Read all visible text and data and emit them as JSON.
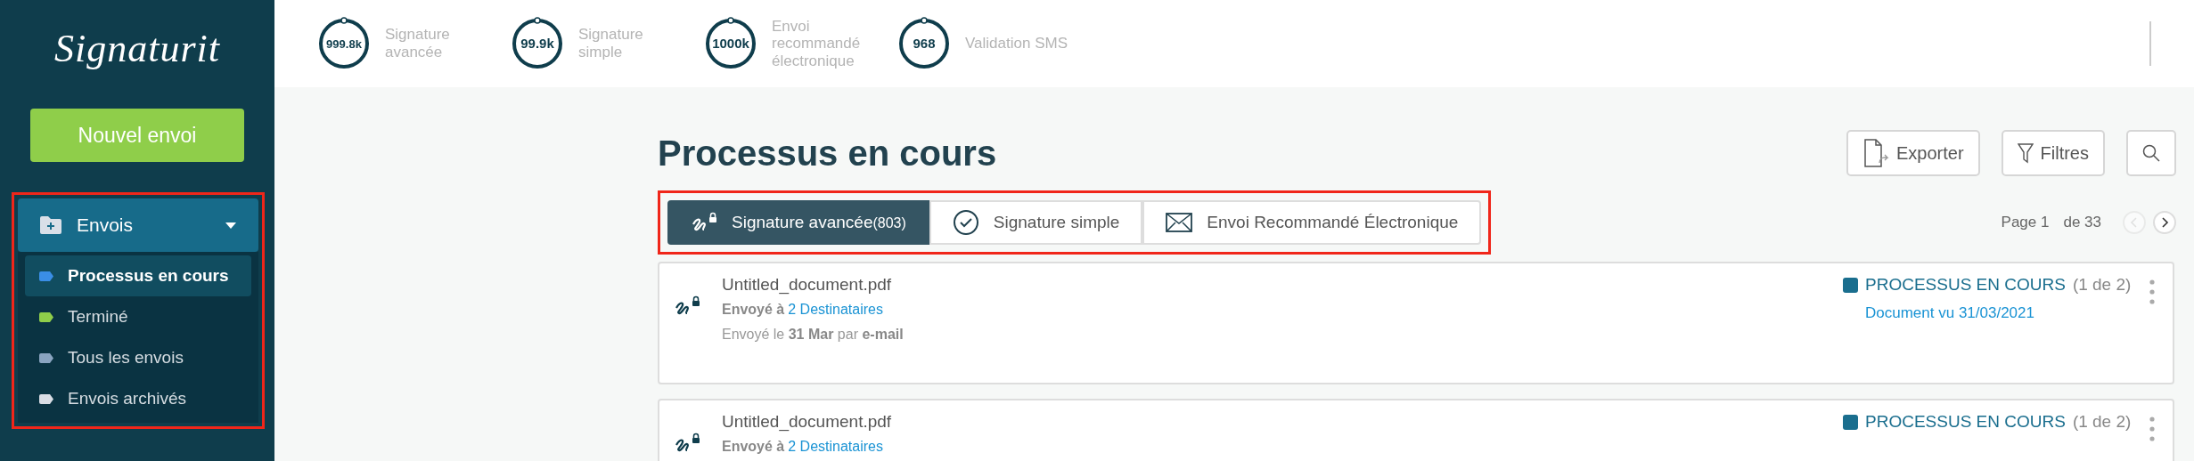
{
  "sidebar": {
    "logo": "Signaturit",
    "new_button": "Nouvel envoi",
    "group": {
      "label": "Envois",
      "expanded": true,
      "highlighted": true,
      "items": [
        {
          "label": "Processus en cours",
          "selected": true,
          "color": "#3a8ee6"
        },
        {
          "label": "Terminé",
          "selected": false,
          "color": "#8fce4a"
        },
        {
          "label": "Tous les envois",
          "selected": false,
          "color": "#8aa4c0"
        },
        {
          "label": "Envois archivés",
          "selected": false,
          "color": "#d9dde4"
        }
      ]
    }
  },
  "stats": [
    {
      "value": "999.8k",
      "label": "Signature avancée"
    },
    {
      "value": "99.9k",
      "label": "Signature simple"
    },
    {
      "value": "1000k",
      "label": "Envoi recommandé électronique"
    },
    {
      "value": "968",
      "label": "Validation SMS"
    }
  ],
  "page": {
    "title": "Processus en cours",
    "actions": [
      {
        "kind": "export",
        "label": "Exporter"
      },
      {
        "kind": "filter",
        "label": "Filtres"
      },
      {
        "kind": "search"
      }
    ],
    "tabs_highlighted": true,
    "tabs": [
      {
        "kind": "advanced",
        "label": "Signature avancée",
        "count": "(803)",
        "selected": true
      },
      {
        "kind": "simple",
        "label": "Signature simple",
        "selected": false
      },
      {
        "kind": "mail",
        "label": "Envoi Recommandé Électronique",
        "selected": false
      }
    ],
    "pagination": {
      "page": "Page 1",
      "total": "de 33",
      "prev_disabled": true,
      "next_disabled": false
    }
  },
  "documents": [
    {
      "name": "Untitled_document.pdf",
      "sent_label": "Envoyé à",
      "recipients": "2 Destinataires",
      "sent_info": "Envoyé le **31 Mar** par **e-mail**",
      "status": "PROCESSUS EN COURS",
      "progress": "(1 de 2)",
      "event": "Document vu 31/03/2021"
    },
    {
      "name": "Untitled_document.pdf",
      "sent_label": "Envoyé à",
      "recipients": "2 Destinataires",
      "status": "PROCESSUS EN COURS",
      "progress": "(1 de 2)"
    }
  ]
}
